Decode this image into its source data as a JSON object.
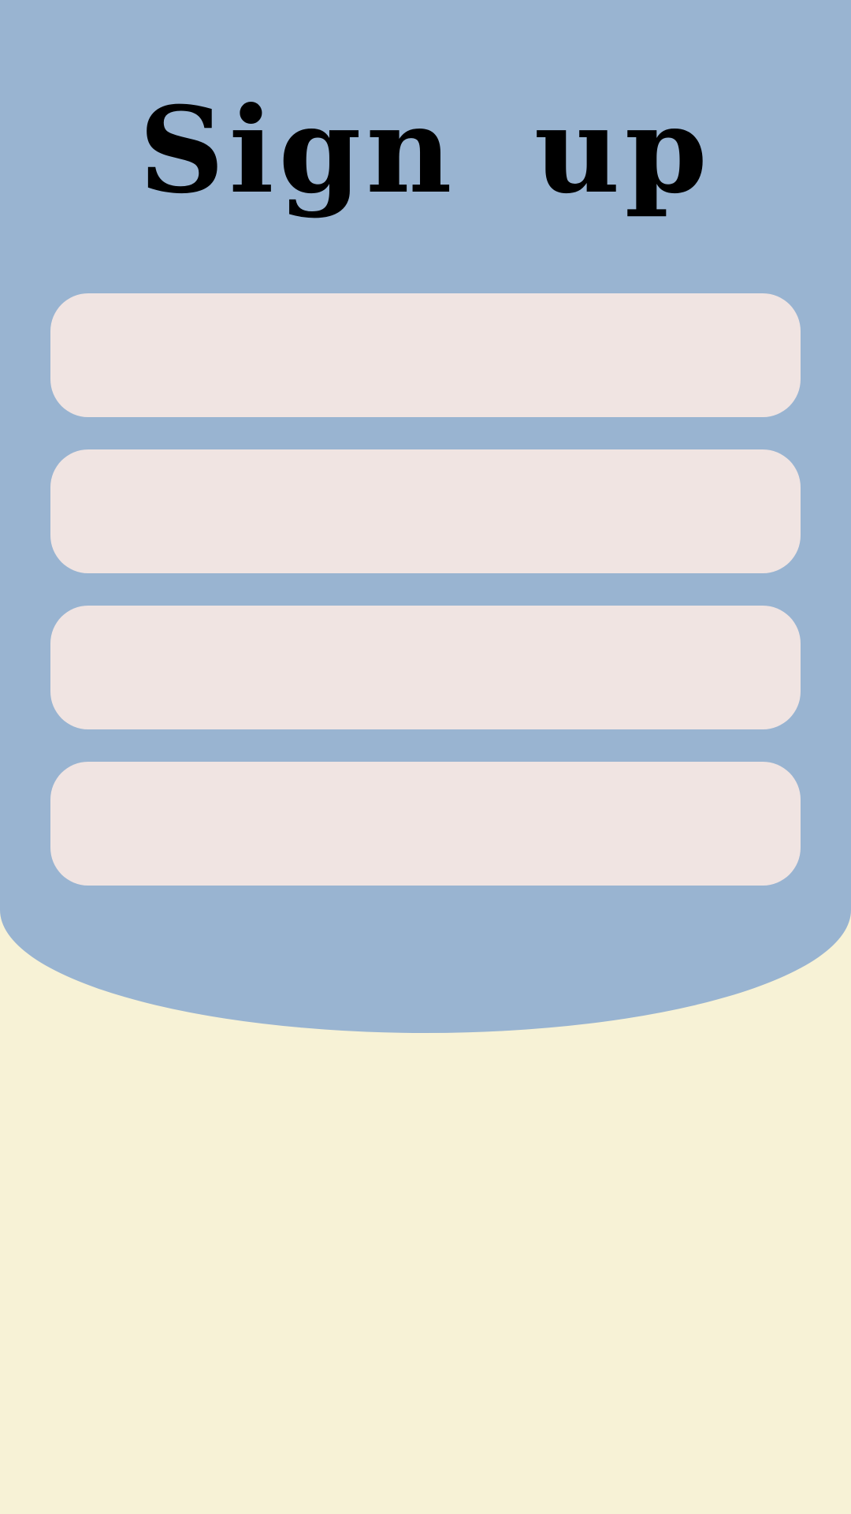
{
  "colors": {
    "page_background": "#f7f2d6",
    "panel_background": "#99b4d1",
    "field_background": "#f0e4e2",
    "title_text": "#000000"
  },
  "header": {
    "title": "Sign up"
  },
  "form": {
    "fields": [
      {
        "value": "",
        "placeholder": ""
      },
      {
        "value": "",
        "placeholder": ""
      },
      {
        "value": "",
        "placeholder": ""
      },
      {
        "value": "",
        "placeholder": ""
      }
    ]
  }
}
